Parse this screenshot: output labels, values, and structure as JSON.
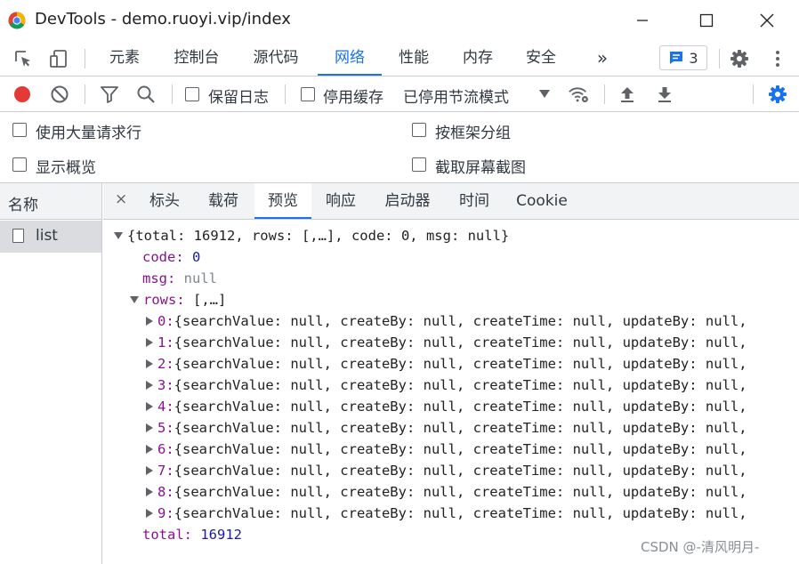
{
  "window": {
    "title": "DevTools - demo.ruoyi.vip/index",
    "chrome_logo": "chrome-logo-icon",
    "controls": [
      "minimize-icon",
      "maximize-icon",
      "close-icon"
    ]
  },
  "main_tabs": [
    {
      "label": "元素",
      "active": false
    },
    {
      "label": "控制台",
      "active": false
    },
    {
      "label": "源代码",
      "active": false
    },
    {
      "label": "网络",
      "active": true
    },
    {
      "label": "性能",
      "active": false
    },
    {
      "label": "内存",
      "active": false
    },
    {
      "label": "安全",
      "active": false
    }
  ],
  "more_tabs_label": "»",
  "issues_count": "3",
  "network_toolbar": {
    "preserve_log_label": "保留日志",
    "disable_cache_label": "停用缓存",
    "throttle_label": "已停用节流模式"
  },
  "settings_panel": {
    "big_rows_label": "使用大量请求行",
    "group_by_frame_label": "按框架分组",
    "overview_label": "显示概览",
    "screenshots_label": "截取屏幕截图"
  },
  "name_panel": {
    "header": "名称",
    "items": [
      {
        "label": "list"
      }
    ]
  },
  "detail_close": "×",
  "detail_tabs": [
    {
      "label": "标头",
      "active": false
    },
    {
      "label": "载荷",
      "active": false
    },
    {
      "label": "预览",
      "active": true
    },
    {
      "label": "响应",
      "active": false
    },
    {
      "label": "启动器",
      "active": false
    },
    {
      "label": "时间",
      "active": false
    },
    {
      "label": "Cookie",
      "active": false
    }
  ],
  "preview": {
    "root_summary": "{total: 16912, rows: [,…], code: 0, msg: null}",
    "code_key": "code:",
    "code_value": "0",
    "msg_key": "msg:",
    "msg_value": "null",
    "rows_key": "rows:",
    "rows_summary": "[,…]",
    "row_summary": "{searchValue: null, createBy: null, createTime: null, updateBy: null,",
    "rows": [
      "0:",
      "1:",
      "2:",
      "3:",
      "4:",
      "5:",
      "6:",
      "7:",
      "8:",
      "9:"
    ],
    "total_key": "total:",
    "total_value": "16912"
  },
  "watermark": "CSDN @-清风明月-",
  "colors": {
    "accent": "#1a73e8",
    "record": "#e53935",
    "key": "#881391",
    "number": "#1a1aa6"
  }
}
